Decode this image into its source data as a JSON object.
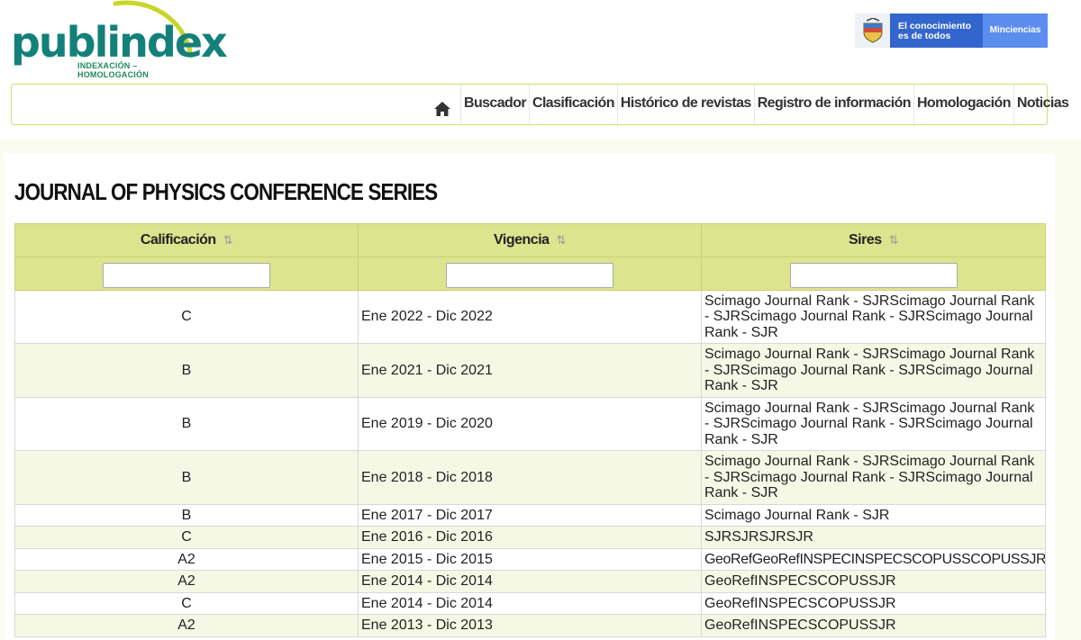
{
  "brand": {
    "logo_text": "publindex",
    "logo_subtitle": "INDEXACIÓN – HOMOLOGACIÓN"
  },
  "gov_banner": {
    "slogan_line1": "El conocimiento",
    "slogan_line2": "es de todos",
    "ministry": "Minciencias",
    "colors": {
      "dark": "#3366cc",
      "light": "#5b8def"
    }
  },
  "nav": {
    "home_icon": "home-icon",
    "items": [
      {
        "label": "Buscador"
      },
      {
        "label": "Clasificación"
      },
      {
        "label": "Histórico de revistas"
      },
      {
        "label": "Registro de información"
      },
      {
        "label": "Homologación"
      },
      {
        "label": "Noticias"
      }
    ]
  },
  "page": {
    "title": "JOURNAL OF PHYSICS CONFERENCE SERIES"
  },
  "table": {
    "columns": [
      {
        "label": "Calificación",
        "sort_icon": "⇅"
      },
      {
        "label": "Vigencia",
        "sort_icon": "⇅"
      },
      {
        "label": "Sires",
        "sort_icon": "⇅"
      }
    ],
    "filters": [
      "",
      "",
      ""
    ],
    "rows": [
      {
        "calificacion": "C",
        "vigencia": "Ene 2022 - Dic 2022",
        "sires": "Scimago Journal Rank - SJRScimago Journal Rank - SJRScimago Journal Rank - SJRScimago Journal Rank - SJR"
      },
      {
        "calificacion": "B",
        "vigencia": "Ene 2021 - Dic 2021",
        "sires": "Scimago Journal Rank - SJRScimago Journal Rank - SJRScimago Journal Rank - SJRScimago Journal Rank - SJR"
      },
      {
        "calificacion": "B",
        "vigencia": "Ene 2019 - Dic 2020",
        "sires": "Scimago Journal Rank - SJRScimago Journal Rank - SJRScimago Journal Rank - SJRScimago Journal Rank - SJR"
      },
      {
        "calificacion": "B",
        "vigencia": "Ene 2018 - Dic 2018",
        "sires": "Scimago Journal Rank - SJRScimago Journal Rank - SJRScimago Journal Rank - SJRScimago Journal Rank - SJR"
      },
      {
        "calificacion": "B",
        "vigencia": "Ene 2017 - Dic 2017",
        "sires": "Scimago Journal Rank - SJR"
      },
      {
        "calificacion": "C",
        "vigencia": "Ene 2016 - Dic 2016",
        "sires": "SJRSJRSJRSJR"
      },
      {
        "calificacion": "A2",
        "vigencia": "Ene 2015 - Dic 2015",
        "sires": "GeoRefGeoRefINSPECINSPECSCOPUSSCOPUSSJRSJR"
      },
      {
        "calificacion": "A2",
        "vigencia": "Ene 2014 - Dic 2014",
        "sires": "GeoRefINSPECSCOPUSSJR"
      },
      {
        "calificacion": "C",
        "vigencia": "Ene 2014 - Dic 2014",
        "sires": "GeoRefINSPECSCOPUSSJR"
      },
      {
        "calificacion": "A2",
        "vigencia": "Ene 2013 - Dic 2013",
        "sires": "GeoRefINSPECSCOPUSSJR"
      }
    ]
  }
}
